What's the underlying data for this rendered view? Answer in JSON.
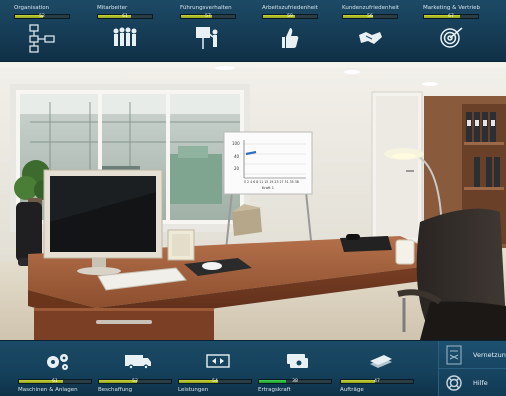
{
  "top_metrics": [
    {
      "label": "Organisation",
      "value": "52",
      "fill": 0.52,
      "icon": "org-chart-icon"
    },
    {
      "label": "Mitarbeiter",
      "value": "61",
      "fill": 0.61,
      "icon": "employees-icon"
    },
    {
      "label": "Führungsverhalten",
      "value": "57",
      "fill": 0.57,
      "icon": "presentation-icon"
    },
    {
      "label": "Arbeitszufriedenheit",
      "value": "59",
      "fill": 0.59,
      "icon": "thumbs-up-icon"
    },
    {
      "label": "Kundenzufriedenheit",
      "value": "56",
      "fill": 0.56,
      "icon": "handshake-icon"
    },
    {
      "label": "Marketing & Vertrieb",
      "value": "67",
      "fill": 0.67,
      "icon": "target-icon"
    }
  ],
  "bottom_metrics": [
    {
      "label": "Maschinen & Anlagen",
      "value": "61",
      "fill": 0.61,
      "icon": "gears-icon"
    },
    {
      "label": "Beschaffung",
      "value": "53",
      "fill": 0.53,
      "icon": "truck-icon"
    },
    {
      "label": "Leistungen",
      "value": "54",
      "fill": 0.54,
      "icon": "product-icon"
    },
    {
      "label": "Ertragskraft",
      "value": "38",
      "fill": 0.38,
      "icon": "money-icon",
      "color": "green"
    },
    {
      "label": "Aufträge",
      "value": "47",
      "fill": 0.47,
      "icon": "orders-icon"
    }
  ],
  "side_buttons": {
    "network_label": "Vernetzung",
    "help_label": "Hilfe"
  },
  "whiteboard": {
    "label": "Kraft 1",
    "y_ticks": [
      "100",
      "40",
      "20"
    ],
    "x_ticks": "0 2 4 6 8 11 15 19 23 27 31 35 38"
  }
}
